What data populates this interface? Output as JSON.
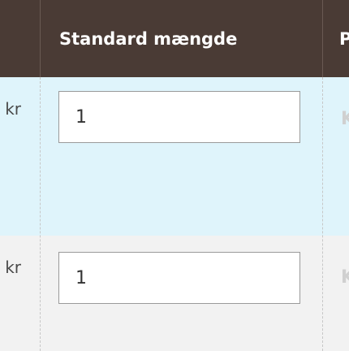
{
  "table": {
    "header": {
      "standard_quantity_label": "Standard mængde",
      "next_column_label": "P"
    },
    "rows": [
      {
        "currency_suffix": "kr",
        "standard_quantity_value": "1",
        "right_ghost_text": "K"
      },
      {
        "currency_suffix": "kr",
        "standard_quantity_value": "1",
        "right_ghost_text": "K"
      }
    ]
  },
  "colors": {
    "header_bg": "#4a3b35",
    "row_highlight_bg": "#dff4fb",
    "row_alt_bg": "#f2f2f2",
    "input_border": "#9a9a9a",
    "divider": "#c7c7c7"
  }
}
